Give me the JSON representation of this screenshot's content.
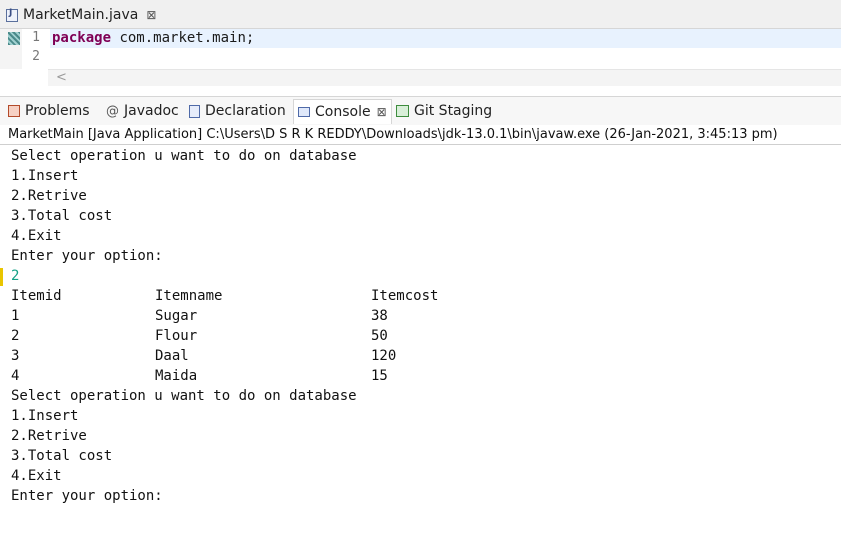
{
  "editor": {
    "tab_label": "MarketMain.java",
    "tab_close": "⊠",
    "lines": [
      {
        "num": "1",
        "keyword": "package",
        "rest": " com.market.main;"
      },
      {
        "num": "2",
        "keyword": "",
        "rest": ""
      }
    ],
    "scroll_left": "<"
  },
  "views": {
    "tabs": [
      {
        "label": "Problems",
        "icon": "problems-icon"
      },
      {
        "label": "Javadoc",
        "icon": "javadoc-icon"
      },
      {
        "label": "Declaration",
        "icon": "declaration-icon"
      },
      {
        "label": "Console",
        "icon": "console-icon",
        "active": true
      },
      {
        "label": "Git Staging",
        "icon": "git-staging-icon"
      }
    ],
    "javadoc_glyph": "@",
    "console_close": "⊠"
  },
  "launch_description": "MarketMain [Java Application] C:\\Users\\D S R K REDDY\\Downloads\\jdk-13.0.1\\bin\\javaw.exe  (26-Jan-2021, 3:45:13 pm)",
  "console": {
    "menu1": [
      "Select operation u want to do on database",
      "1.Insert",
      "2.Retrive",
      "3.Total cost",
      "4.Exit",
      "Enter your option:"
    ],
    "user_input": "2",
    "table": {
      "headers": [
        "Itemid",
        "Itemname",
        "Itemcost"
      ],
      "rows": [
        [
          "1",
          "Sugar",
          "38"
        ],
        [
          "2",
          "Flour",
          "50"
        ],
        [
          "3",
          "Daal",
          "120"
        ],
        [
          "4",
          "Maida",
          "15"
        ]
      ]
    },
    "menu2": [
      "Select operation u want to do on database",
      "1.Insert",
      "2.Retrive",
      "3.Total cost",
      "4.Exit",
      "Enter your option:"
    ]
  },
  "colors": {
    "keyword": "#7f0055",
    "input_text": "#14a085",
    "current_line": "#e8f2fe"
  }
}
